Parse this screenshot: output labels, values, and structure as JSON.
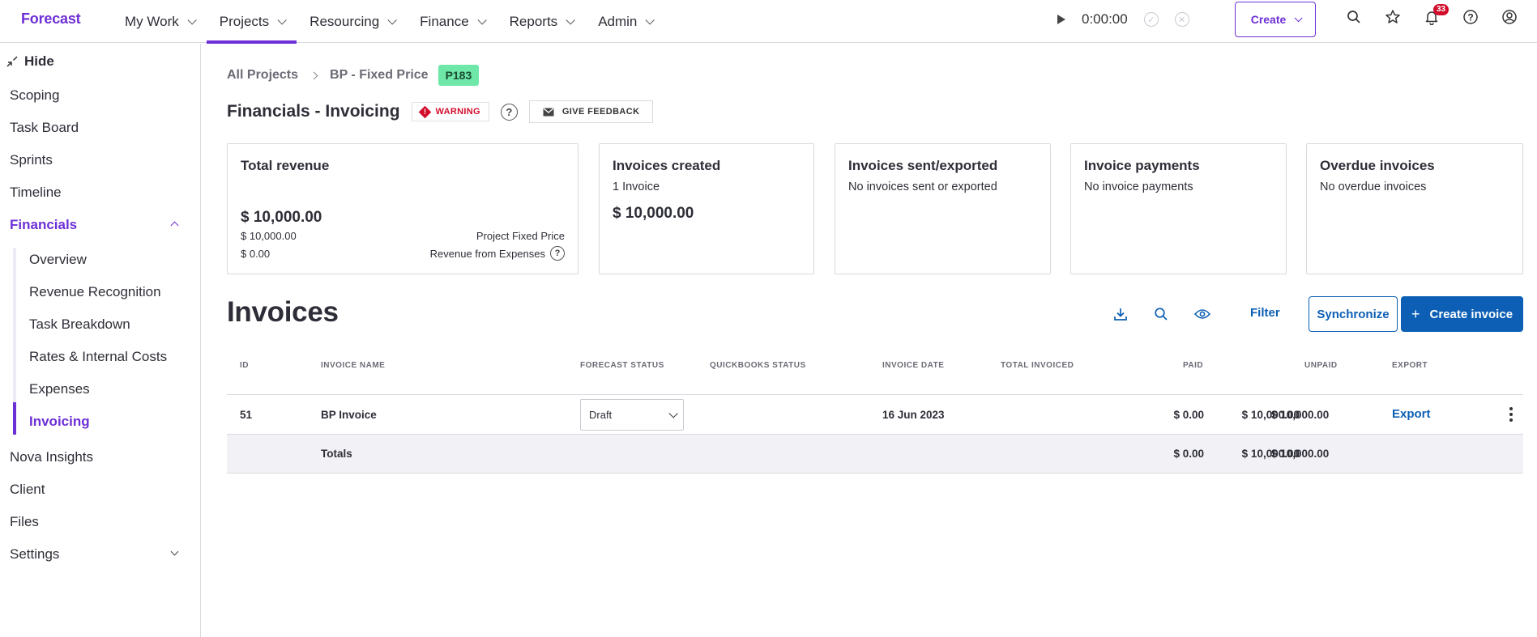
{
  "app": {
    "logo": "Forecast"
  },
  "nav": {
    "items": [
      {
        "label": "My Work",
        "active": false
      },
      {
        "label": "Projects",
        "active": true
      },
      {
        "label": "Resourcing",
        "active": false
      },
      {
        "label": "Finance",
        "active": false
      },
      {
        "label": "Reports",
        "active": false
      },
      {
        "label": "Admin",
        "active": false
      }
    ]
  },
  "timer": {
    "time": "0:00:00"
  },
  "create_label": "Create",
  "notifications_count": "33",
  "sidebar": {
    "hide_label": "Hide",
    "items": [
      "Scoping",
      "Task Board",
      "Sprints",
      "Timeline"
    ],
    "financials_label": "Financials",
    "financials_sub": [
      "Overview",
      "Revenue Recognition",
      "Task Breakdown",
      "Rates & Internal Costs",
      "Expenses",
      "Invoicing"
    ],
    "after_items": [
      "Nova Insights",
      "Client",
      "Files"
    ],
    "settings_label": "Settings"
  },
  "breadcrumb": {
    "root": "All Projects",
    "project": "BP - Fixed Price",
    "project_id": "P183"
  },
  "page": {
    "title": "Financials - Invoicing",
    "warning_label": "WARNING",
    "help": "?",
    "feedback_label": "GIVE FEEDBACK"
  },
  "cards": {
    "revenue": {
      "title": "Total revenue",
      "total": "$ 10,000.00",
      "line1_value": "$ 10,000.00",
      "line1_label": "Project Fixed Price",
      "line2_value": "$ 0.00",
      "line2_label": "Revenue from Expenses"
    },
    "created": {
      "title": "Invoices created",
      "sub": "1 Invoice",
      "amount": "$ 10,000.00"
    },
    "sent": {
      "title": "Invoices sent/exported",
      "sub": "No invoices sent or exported"
    },
    "payments": {
      "title": "Invoice payments",
      "sub": "No invoice payments"
    },
    "overdue": {
      "title": "Overdue invoices",
      "sub": "No overdue invoices"
    }
  },
  "invoices": {
    "title": "Invoices",
    "filter_label": "Filter",
    "sync_label": "Synchronize",
    "create_label": "Create invoice",
    "columns": {
      "id": "ID",
      "name": "INVOICE NAME",
      "forecast_status": "FORECAST STATUS",
      "qb_status": "QUICKBOOKS STATUS",
      "date": "INVOICE DATE",
      "total": "TOTAL INVOICED",
      "paid": "PAID",
      "unpaid": "UNPAID",
      "export": "EXPORT"
    },
    "row": {
      "id": "51",
      "name": "BP Invoice",
      "status": "Draft",
      "date": "16 Jun 2023",
      "total": "$ 10,000.00",
      "paid": "$ 0.00",
      "unpaid": "$ 10,000.00",
      "export_label": "Export"
    },
    "totals": {
      "label": "Totals",
      "total": "$ 10,000.00",
      "paid": "$ 0.00",
      "unpaid": "$ 10,000.00"
    }
  },
  "colors": {
    "brand": "#6d2fd6",
    "primary": "#0c5fb4",
    "warning": "#d20d2c",
    "badge": "#6ee7a8"
  }
}
